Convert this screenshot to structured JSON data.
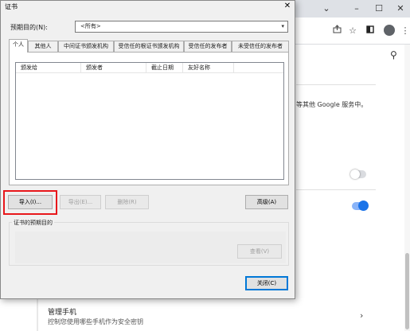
{
  "browser": {
    "window_controls": {
      "chevron": "⌄",
      "minimize": "–",
      "maximize": "☐",
      "close": "✕"
    },
    "toolbar_icons": [
      "share-icon",
      "star-icon",
      "sidebar-icon",
      "profile-icon",
      "menu-icon"
    ],
    "bg_text": "等其他 Google 服务中。",
    "items": [
      {
        "title": "管理手机",
        "description": "控制您使用哪些手机作为安全密钥"
      }
    ],
    "colors": {
      "toggle_on": "#1a73e8",
      "toggle_off": "#dadce0"
    }
  },
  "dialog": {
    "title": "证书",
    "close_symbol": "✕",
    "purpose_label": "预期目的(N):",
    "purpose_value": "<所有>",
    "tabs": [
      "个人",
      "其他人",
      "中间证书颁发机构",
      "受信任的根证书颁发机构",
      "受信任的发布者",
      "未受信任的发布者"
    ],
    "active_tab": 0,
    "columns": [
      "颁发给",
      "颁发者",
      "截止日期",
      "友好名称"
    ],
    "buttons": {
      "import": "导入(I)...",
      "export": "导出(E)...",
      "remove": "删除(R)",
      "advanced": "高级(A)",
      "view": "查看(V)",
      "close": "关闭(C)"
    },
    "group_label": "证书的预期目的",
    "highlight_color": "#e8171b"
  }
}
